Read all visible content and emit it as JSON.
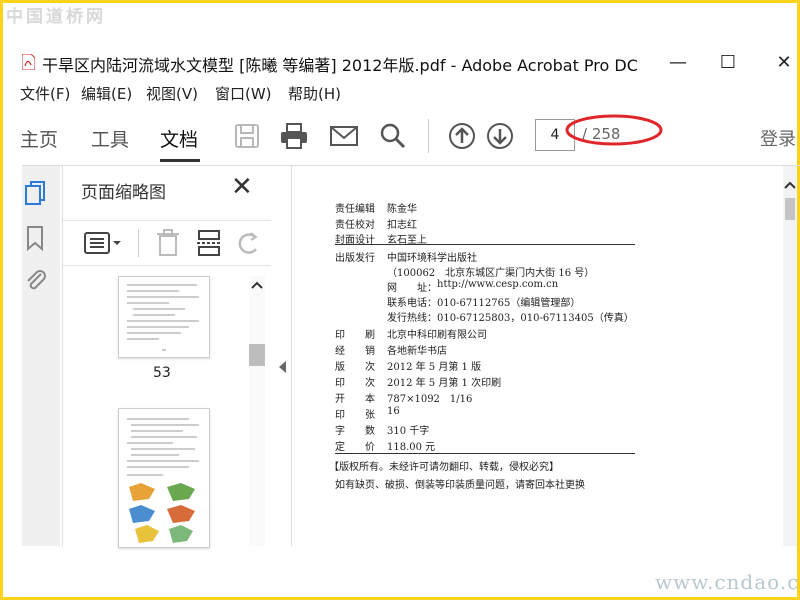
{
  "watermarks": {
    "top": "中国道桥网",
    "bottom": "www.cndao.com"
  },
  "window": {
    "title": "干旱区内陆河流域水文模型 [陈曦 等编著] 2012年版.pdf - Adobe Acrobat Pro DC",
    "minimize_glyph": "—",
    "maximize_glyph": "☐",
    "close_glyph": "✕"
  },
  "menu": [
    "文件(F)",
    "编辑(E)",
    "视图(V)",
    "窗口(W)",
    "帮助(H)"
  ],
  "tabs": {
    "home": "主页",
    "tools": "工具",
    "document": "文档"
  },
  "toolbar": {
    "icons": [
      "save-icon",
      "print-icon",
      "email-icon",
      "search-icon",
      "page-up-icon",
      "page-down-icon"
    ],
    "page_input_value": "4",
    "page_total": "/ 258",
    "login": "登录",
    "annotation_color": "#e0262a"
  },
  "thumbnail_panel": {
    "title": "页面缩略图",
    "close": "✕",
    "page_label": "53"
  },
  "document": {
    "editor_label": "责任编辑",
    "editor": "陈金华",
    "proof_label": "责任校对",
    "proof": "扣志红",
    "cover_label": "封面设计",
    "cover": "玄石至上",
    "publisher_label": "出版发行",
    "publisher": "中国环境科学出版社",
    "address": "（100062　北京东城区广渠门内大街 16 号）",
    "website_label": "网　　址：",
    "website": "http://www.cesp.com.cn",
    "phone_label": "联系电话：",
    "phone": "010-67112765（编辑管理部）",
    "hotline_label": "发行热线：",
    "hotline": "010-67125803，010-67113405（传真）",
    "print_label": "印　　刷",
    "print": "北京中科印刷有限公司",
    "sell_label": "经　　销",
    "sell": "各地新华书店",
    "edition_label": "版　　次",
    "edition": "2012 年 5 月第 1 版",
    "impression_label": "印　　次",
    "impression": "2012 年 5 月第 1 次印刷",
    "format_label": "开　　本",
    "format": "787×1092　1/16",
    "sheets_label": "印　　张",
    "sheets": "16",
    "words_label": "字　　数",
    "words": "310 千字",
    "price_label": "定　　价",
    "price": "118.00 元",
    "copyright": "【版权所有。未经许可请勿翻印、转载，侵权必究】",
    "notice": "如有缺页、破损、倒装等印装质量问题，请寄回本社更换"
  }
}
